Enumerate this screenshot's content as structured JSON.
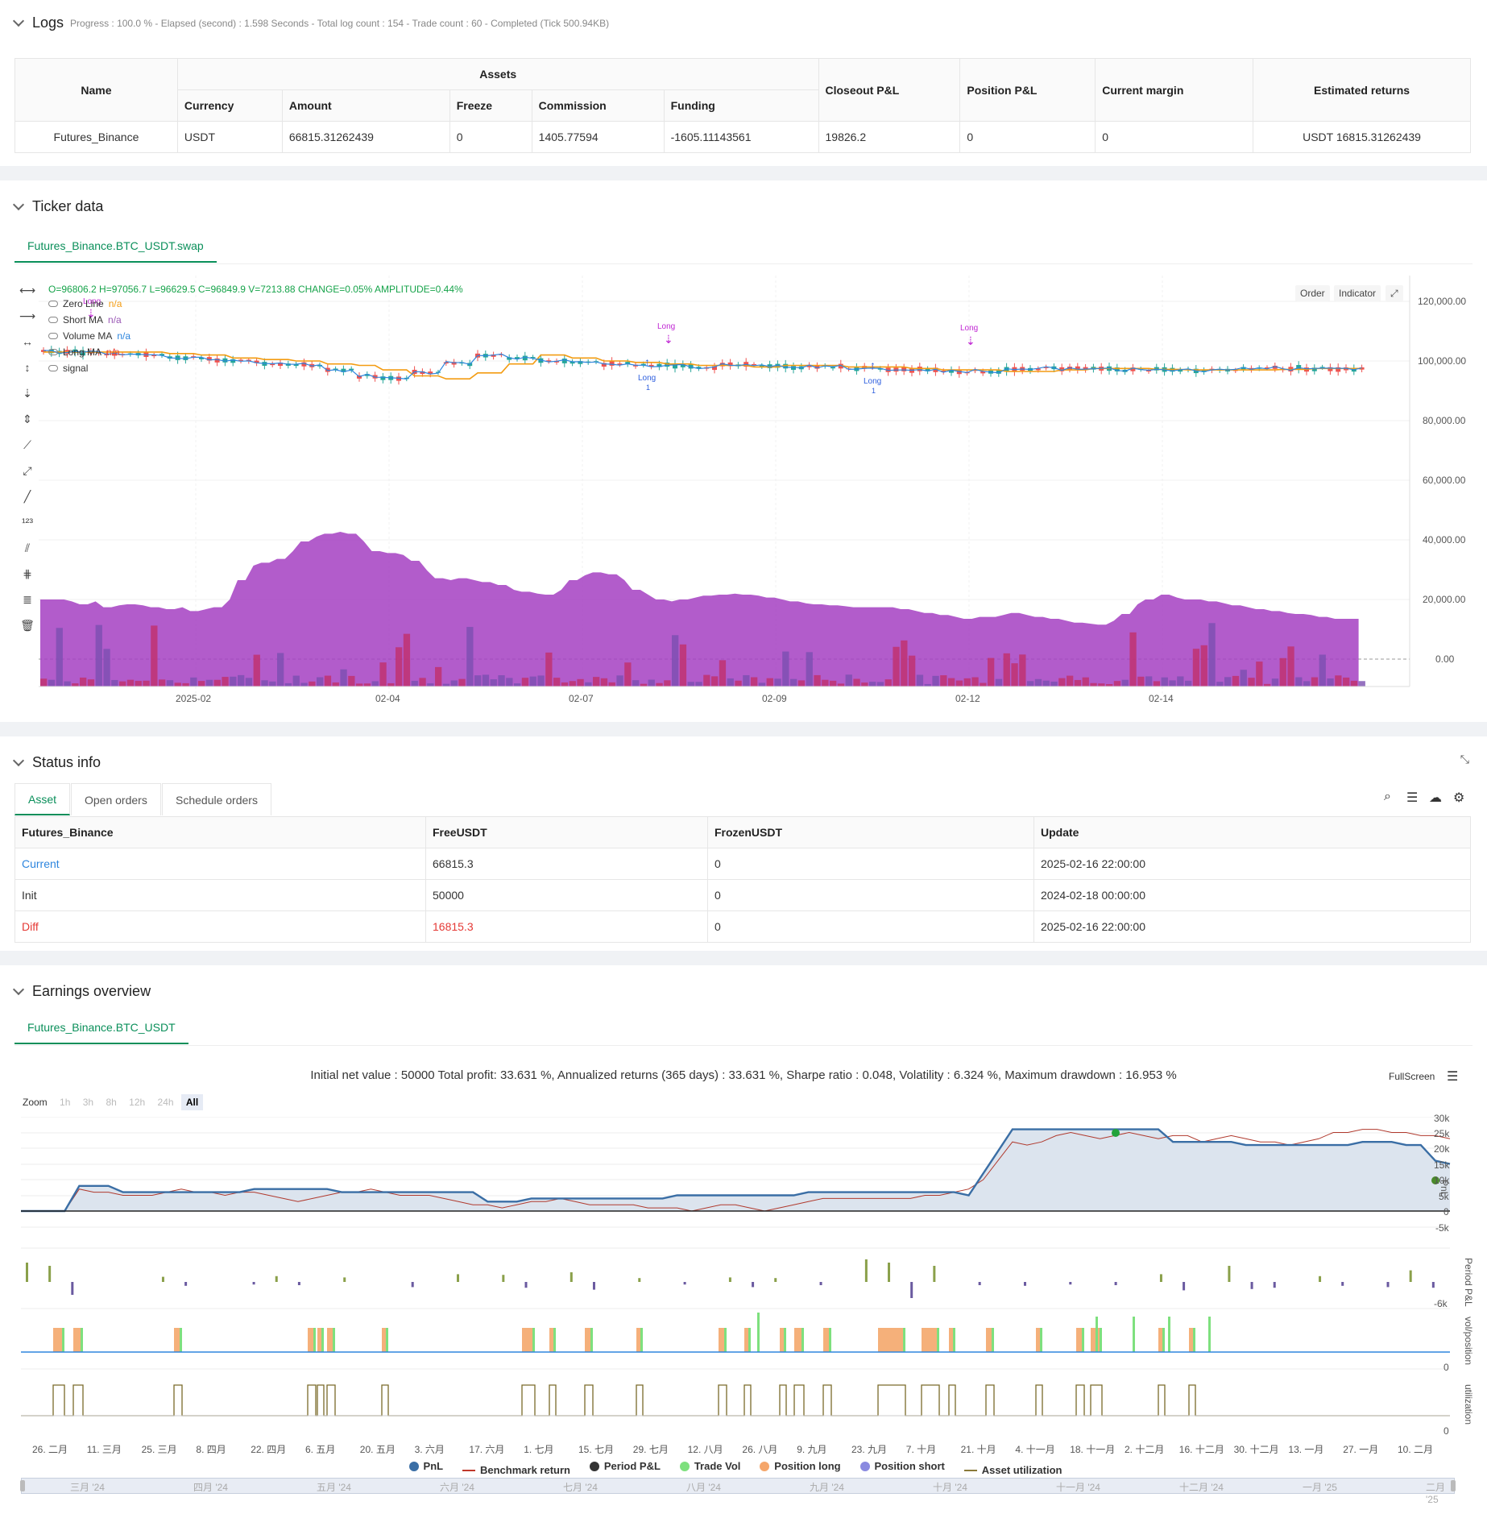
{
  "logs": {
    "title": "Logs",
    "summary": "Progress : 100.0 % - Elapsed (second) : 1.598  Seconds - Total log count : 154 - Trade count : 60 - Completed (Tick 500.94KB)",
    "assets_header": "Assets",
    "columns": [
      "Name",
      "Currency",
      "Amount",
      "Freeze",
      "Commission",
      "Funding",
      "Closeout P&L",
      "Position P&L",
      "Current margin",
      "Estimated returns"
    ],
    "row": [
      "Futures_Binance",
      "USDT",
      "66815.31262439",
      "0",
      "1405.77594",
      "-1605.11143561",
      "19826.2",
      "0",
      "0",
      "USDT 16815.31262439"
    ]
  },
  "ticker": {
    "title": "Ticker data",
    "tab": "Futures_Binance.BTC_USDT.swap",
    "ohlc": "O=96806.2 H=97056.7 L=96629.5 C=96849.9 V=7213.88 CHANGE=0.05% AMPLITUDE=0.44%",
    "legend": [
      {
        "name": "Zero Line",
        "val": "n/a",
        "color": "#f39c12"
      },
      {
        "name": "Short MA",
        "val": "n/a",
        "color": "#9b59b6"
      },
      {
        "name": "Volume MA",
        "val": "n/a",
        "color": "#2e86de"
      },
      {
        "name": "Long MA",
        "val": "n/a",
        "color": "#e74c3c"
      },
      {
        "name": "signal",
        "val": "",
        "color": "#555"
      }
    ],
    "buttons": [
      "Order",
      "Indicator"
    ],
    "y_ticks": [
      "120,000.00",
      "100,000.00",
      "80,000.00",
      "60,000.00",
      "40,000.00",
      "20,000.00",
      "0.00"
    ],
    "x_ticks": [
      "2025-02",
      "02-04",
      "02-07",
      "02-09",
      "02-12",
      "02-14"
    ],
    "markers": [
      {
        "label": "Long",
        "type": "short-arrow"
      },
      {
        "label": "Long",
        "type": "short-arrow"
      },
      {
        "label": "Long",
        "type": "short-arrow"
      },
      {
        "label": "Long",
        "sub": "1",
        "type": "long-arrow"
      },
      {
        "label": "Long",
        "sub": "1",
        "type": "long-arrow"
      }
    ]
  },
  "status": {
    "title": "Status info",
    "tabs": [
      "Asset",
      "Open orders",
      "Schedule orders"
    ],
    "columns": [
      "Futures_Binance",
      "FreeUSDT",
      "FrozenUSDT",
      "Update"
    ],
    "rows": [
      {
        "name": "Current",
        "free": "66815.3",
        "frozen": "0",
        "update": "2025-02-16 22:00:00",
        "color": "#2e86de",
        "freeColor": "#333"
      },
      {
        "name": "Init",
        "free": "50000",
        "frozen": "0",
        "update": "2024-02-18 00:00:00",
        "color": "#333",
        "freeColor": "#333"
      },
      {
        "name": "Diff",
        "free": "16815.3",
        "frozen": "0",
        "update": "2025-02-16 22:00:00",
        "color": "#e53935",
        "freeColor": "#e53935"
      }
    ]
  },
  "earnings": {
    "title": "Earnings overview",
    "tab": "Futures_Binance.BTC_USDT",
    "summary": "Initial net value : 50000 Total profit: 33.631 %, Annualized returns (365 days) : 33.631 %, Sharpe ratio : 0.048, Volatility : 6.324 %, Maximum drawdown : 16.953 %",
    "fullscreen": "FullScreen",
    "zoom_label": "Zoom",
    "zoom_buttons": [
      "1h",
      "3h",
      "8h",
      "12h",
      "24h",
      "All"
    ],
    "pnl_ticks": [
      "30k",
      "25k",
      "20k",
      "15k",
      "10k",
      "5k",
      "0",
      "-5k"
    ],
    "axis_names": [
      "PnL",
      "Period P&L",
      "vol/position",
      "utilization"
    ],
    "period_tick": "-6k",
    "zero": "0",
    "x_ticks": [
      "26. 二月",
      "11. 三月",
      "25. 三月",
      "8. 四月",
      "22. 四月",
      "6. 五月",
      "20. 五月",
      "3. 六月",
      "17. 六月",
      "1. 七月",
      "15. 七月",
      "29. 七月",
      "12. 八月",
      "26. 八月",
      "9. 九月",
      "23. 九月",
      "7. 十月",
      "21. 十月",
      "4. 十一月",
      "18. 十一月",
      "2. 十二月",
      "16. 十二月",
      "30. 十二月",
      "13. 一月",
      "27. 一月",
      "10. 二月"
    ],
    "nav_ticks": [
      "三月 '24",
      "四月 '24",
      "五月 '24",
      "六月 '24",
      "七月 '24",
      "八月 '24",
      "九月 '24",
      "十月 '24",
      "十一月 '24",
      "十二月 '24",
      "一月 '25",
      "二月 '25"
    ],
    "legend": [
      {
        "name": "PnL",
        "color": "#3a6ea5",
        "kind": "dot"
      },
      {
        "name": "Benchmark return",
        "color": "#c0392b",
        "kind": "line"
      },
      {
        "name": "Period P&L",
        "color": "#333",
        "kind": "dot"
      },
      {
        "name": "Trade Vol",
        "color": "#7ee07e",
        "kind": "dot"
      },
      {
        "name": "Position long",
        "color": "#f5a66b",
        "kind": "dot"
      },
      {
        "name": "Position short",
        "color": "#8a8ae0",
        "kind": "dot"
      },
      {
        "name": "Asset utilization",
        "color": "#8a7a3a",
        "kind": "line"
      }
    ]
  },
  "chart_data": [
    {
      "type": "line",
      "title": "",
      "ylim": [
        -5000,
        30000
      ],
      "series": [
        {
          "name": "PnL",
          "values": [
            0,
            0,
            0,
            0,
            8000,
            8000,
            8000,
            6000,
            6000,
            6000,
            6000,
            6000,
            6000,
            6000,
            6000,
            6000,
            7000,
            7000,
            7000,
            7000,
            7000,
            7000,
            6000,
            6000,
            6000,
            6000,
            6000,
            6000,
            6000,
            6000,
            6000,
            6000,
            3000,
            3000,
            3000,
            4000,
            4000,
            4000,
            4000,
            4000,
            4000,
            4000,
            4000,
            4000,
            4000,
            5000,
            5000,
            5000,
            5000,
            5000,
            5000,
            5000,
            5000,
            5000,
            6000,
            6000,
            6000,
            6000,
            6000,
            6000,
            6000,
            6000,
            6000,
            6000,
            6000,
            5000,
            12000,
            19000,
            26000,
            26000,
            26000,
            26000,
            26000,
            26000,
            26000,
            26000,
            26000,
            26000,
            26000,
            22000,
            22000,
            22000,
            22000,
            22000,
            21000,
            21000,
            21000,
            21000,
            21000,
            21000,
            21000,
            21000,
            22000,
            22000,
            22000,
            21000,
            21000,
            16000,
            15000
          ]
        },
        {
          "name": "Benchmark return",
          "values": [
            0,
            0,
            0,
            0,
            7000,
            6000,
            6000,
            5000,
            5000,
            5000,
            6000,
            7000,
            6000,
            6000,
            5000,
            6000,
            6000,
            5000,
            4000,
            3000,
            4000,
            5000,
            6000,
            6000,
            7000,
            6000,
            5000,
            5000,
            5000,
            4000,
            3000,
            2000,
            2000,
            1000,
            2000,
            3000,
            3000,
            4000,
            3000,
            2000,
            2000,
            2000,
            2000,
            1000,
            1000,
            1000,
            0,
            1000,
            2000,
            2000,
            1000,
            0,
            1000,
            2000,
            3000,
            4000,
            4000,
            4000,
            4000,
            4000,
            4000,
            4000,
            5000,
            5000,
            6000,
            7000,
            10000,
            16000,
            22000,
            21000,
            22000,
            24000,
            25000,
            24000,
            23000,
            24000,
            25000,
            24000,
            23000,
            24000,
            24000,
            22000,
            23000,
            24000,
            23000,
            22000,
            22000,
            21000,
            22000,
            23000,
            25000,
            25000,
            26000,
            26000,
            25000,
            25000,
            24000,
            24000,
            23000
          ]
        }
      ]
    },
    {
      "type": "bar",
      "title": "",
      "series": [
        {
          "name": "Period P&L",
          "values": [
            3000,
            2500,
            -2000,
            0,
            0,
            0,
            800,
            -600,
            0,
            0,
            -400,
            900,
            -500,
            0,
            700,
            0,
            0,
            -800,
            0,
            1200,
            0,
            1100,
            -900,
            0,
            1500,
            -1200,
            0,
            600,
            0,
            -400,
            0,
            700,
            -800,
            600,
            0,
            -500,
            0,
            3500,
            3000,
            -2500,
            2500,
            0,
            -500,
            0,
            -600,
            0,
            -400,
            0,
            -500,
            0,
            1200,
            -1300,
            0,
            2500,
            -1100,
            -900,
            0,
            900,
            -600,
            0,
            -800,
            1800,
            -900
          ]
        }
      ]
    }
  ]
}
